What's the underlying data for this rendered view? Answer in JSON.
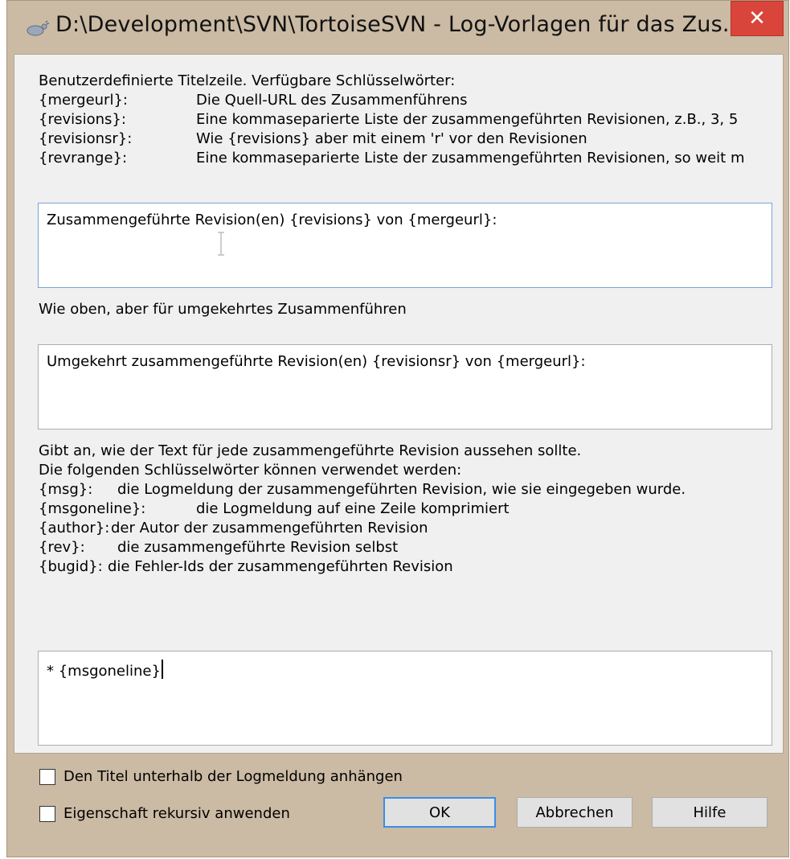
{
  "window": {
    "title": "D:\\Development\\SVN\\TortoiseSVN - Log-Vorlagen für das Zus...",
    "close_symbol": "✕"
  },
  "section1": {
    "intro": "Benutzerdefinierte Titelzeile. Verfügbare Schlüsselwörter:",
    "keywords": [
      {
        "key": "{mergeurl}:",
        "desc": "Die Quell-URL des Zusammenführens"
      },
      {
        "key": "{revisions}:",
        "desc": "Eine kommaseparierte Liste der zusammengeführten Revisionen, z.B., 3, 5"
      },
      {
        "key": "{revisionsr}:",
        "desc": "Wie {revisions} aber mit einem 'r' vor den Revisionen"
      },
      {
        "key": "{revrange}:",
        "desc": "Eine kommaseparierte Liste der zusammengeführten Revisionen, so weit m"
      }
    ],
    "input_value": "Zusammengeführte Revision(en) {revisions} von {mergeurl}:"
  },
  "section2": {
    "label": "Wie oben, aber für umgekehrtes Zusammenführen",
    "input_value": "Umgekehrt zusammengeführte Revision(en) {revisionsr} von {mergeurl}:"
  },
  "section3": {
    "intro1": "Gibt an, wie der Text für jede zusammengeführte Revision aussehen sollte.",
    "intro2": "Die folgenden Schlüsselwörter können verwendet werden:",
    "keywords": [
      {
        "key": "{msg}:",
        "desc": "die Logmeldung der zusammengeführten Revision, wie sie eingegeben wurde."
      },
      {
        "key": "{msgoneline}:",
        "desc": "die Logmeldung auf eine Zeile komprimiert"
      },
      {
        "key": "{author}:",
        "desc": "der Autor der zusammengeführten Revision"
      },
      {
        "key": "{rev}:",
        "desc": "die zusammengeführte Revision selbst"
      },
      {
        "key": "{bugid}:",
        "desc": "die Fehler-Ids der zusammengeführten Revision"
      }
    ],
    "input_value": "* {msgoneline}"
  },
  "options": {
    "append_title": "Den Titel unterhalb der Logmeldung anhängen",
    "recursive": "Eigenschaft rekursiv anwenden"
  },
  "buttons": {
    "ok": "OK",
    "cancel": "Abbrechen",
    "help": "Hilfe"
  },
  "colors": {
    "frame": "#cbbaa4",
    "close": "#d9453a",
    "client": "#f0f0f0",
    "default_button_border": "#3a8ee6"
  }
}
